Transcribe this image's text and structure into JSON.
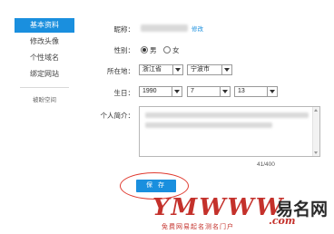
{
  "sidebar": {
    "items": [
      {
        "label": "基本资料",
        "active": true
      },
      {
        "label": "修改头像",
        "active": false
      },
      {
        "label": "个性域名",
        "active": false
      },
      {
        "label": "绑定网站",
        "active": false
      }
    ],
    "extra": "被盼空间"
  },
  "form": {
    "nickname_label": "昵称：",
    "edit_link": "修改",
    "gender_label": "性别：",
    "gender_options": [
      "男",
      "女"
    ],
    "gender_selected": "男",
    "location_label": "所在地：",
    "province": "浙江省",
    "city": "宁波市",
    "birthday_label": "生日：",
    "birth_year": "1990",
    "birth_month": "7",
    "birth_day": "13",
    "bio_label": "个人简介：",
    "bio_counter": "41/400",
    "save_label": "保 存"
  },
  "watermark": {
    "word": "YMWWW",
    "cn_name": "易名网",
    "domain": ".com",
    "slogan": "免费网易起名测名门户"
  },
  "colors": {
    "accent": "#1a8fde",
    "highlight": "#e03c31"
  }
}
